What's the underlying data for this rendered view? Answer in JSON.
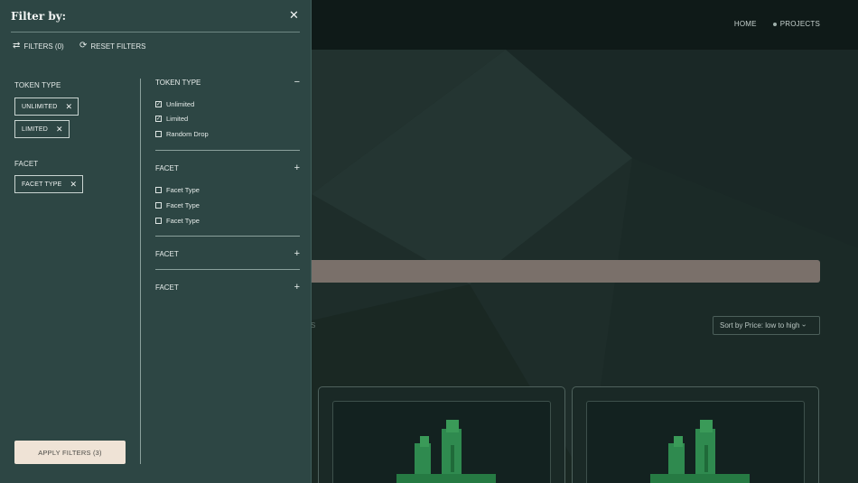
{
  "nav": {
    "home": "HOME",
    "projects": "PROJECTS"
  },
  "page": {
    "results_fragment": "S",
    "sort_label": "Sort by Price: low to high"
  },
  "panel": {
    "title": "Filter by:",
    "filters_label": "FILTERS (0)",
    "reset_label": "RESET FILTERS",
    "selected_groups": [
      {
        "heading": "TOKEN TYPE",
        "chips": [
          "UNLIMITED",
          "LIMITED"
        ]
      },
      {
        "heading": "FACET",
        "chips": [
          "FACET TYPE"
        ]
      }
    ],
    "sections": [
      {
        "title": "TOKEN TYPE",
        "expanded": true,
        "toggle": "−",
        "options": [
          {
            "label": "Unlimited",
            "checked": true
          },
          {
            "label": "Limited",
            "checked": true
          },
          {
            "label": "Random Drop",
            "checked": false
          }
        ]
      },
      {
        "title": "FACET",
        "expanded": true,
        "toggle": "+",
        "options": [
          {
            "label": "Facet Type",
            "checked": false
          },
          {
            "label": "Facet Type",
            "checked": false
          },
          {
            "label": "Facet Type",
            "checked": false
          }
        ]
      },
      {
        "title": "FACET",
        "expanded": false,
        "toggle": "+",
        "options": []
      },
      {
        "title": "FACET",
        "expanded": false,
        "toggle": "+",
        "options": []
      }
    ],
    "apply_label": "APPLY FILTERS (3)"
  },
  "colors": {
    "panel_bg": "#2d4644",
    "apply_bg": "#efe3d6",
    "search_bar": "#7a706a",
    "art_green": "#2f8a4f"
  }
}
